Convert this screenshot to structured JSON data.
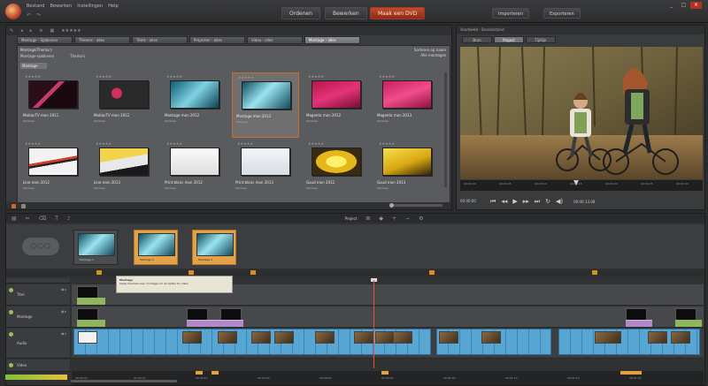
{
  "app": {
    "menu": [
      "Bestand",
      "Bewerken",
      "Instellingen",
      "Help"
    ],
    "main_tabs": [
      "Ordenen",
      "Bewerken",
      "Maak een DVD"
    ],
    "active_main_tab": 2,
    "right_buttons": [
      "Importeren",
      "Exporteren"
    ],
    "window_controls": [
      "_",
      "□",
      "×"
    ]
  },
  "library": {
    "tabs": [
      "Montage - Sjablonen",
      "Themes - alles",
      "Titels - alles",
      "Projecten - alles",
      "Video - alles",
      "Montage - alles"
    ],
    "active_tab": 5,
    "path": "Montage/Thema's",
    "sub_items": [
      "Montage-sjablonen",
      "Thema's"
    ],
    "category": "Montage",
    "right_info": [
      "Sorteren op naam",
      "Alle montages"
    ],
    "items": [
      {
        "label": "MotionTV mon 2011",
        "meta": "Montage"
      },
      {
        "label": "MotionTV mon 2012",
        "meta": "Montage"
      },
      {
        "label": "Montage mon 2012",
        "meta": "Montage"
      },
      {
        "label": "Montage mon 2013",
        "meta": "Montage"
      },
      {
        "label": "Magenta mon 2012",
        "meta": "Montage"
      },
      {
        "label": "Magenta mon 2013",
        "meta": "Montage"
      },
      {
        "label": "Line mon 2012",
        "meta": "Montage"
      },
      {
        "label": "Line mon 2013",
        "meta": "Montage"
      },
      {
        "label": "Print blanc mon 2012",
        "meta": "Montage"
      },
      {
        "label": "Print blanc mon 2013",
        "meta": "Montage"
      },
      {
        "label": "Goud mon 2012",
        "meta": "Montage"
      },
      {
        "label": "Goud mon 2013",
        "meta": "Montage"
      }
    ]
  },
  "player": {
    "title": "Voorbeeld - Bronbestand",
    "tabs": [
      "Bron",
      "Project",
      "Tijdlijn"
    ],
    "active_tab": 1,
    "ruler_labels": [
      "00:00:00",
      "00:00:05",
      "00:00:10",
      "00:00:15",
      "00:00:20",
      "00:00:25",
      "00:00:30"
    ],
    "timecode_left": "00:00:00",
    "timecode_right": "00:00:13.08"
  },
  "timeline": {
    "dropdown": "Project",
    "storyboard_clips": [
      {
        "label": "Montage 1",
        "state": "default"
      },
      {
        "label": "Montage 2",
        "state": "selected"
      },
      {
        "label": "Montage 3",
        "state": "selected"
      }
    ],
    "tooltip_title": "Montage",
    "tooltip_text": "Sleep hierheen een montage om de tijdlijn te vullen",
    "tracks": [
      {
        "label": "Titel"
      },
      {
        "label": "Montage"
      },
      {
        "label": "Audio"
      },
      {
        "label": "Video"
      }
    ],
    "ruler_labels": [
      "00:00:00",
      "00:00:10",
      "00:00:20",
      "00:00:30",
      "00:00:40",
      "00:00:50",
      "00:01:00",
      "00:01:10",
      "00:01:20",
      "00:01:30"
    ]
  },
  "colors": {
    "accent": "#c24a2c",
    "track_blue": "#58a6d4",
    "audio_purple": "#b289c8",
    "marker_orange": "#e0891e"
  }
}
